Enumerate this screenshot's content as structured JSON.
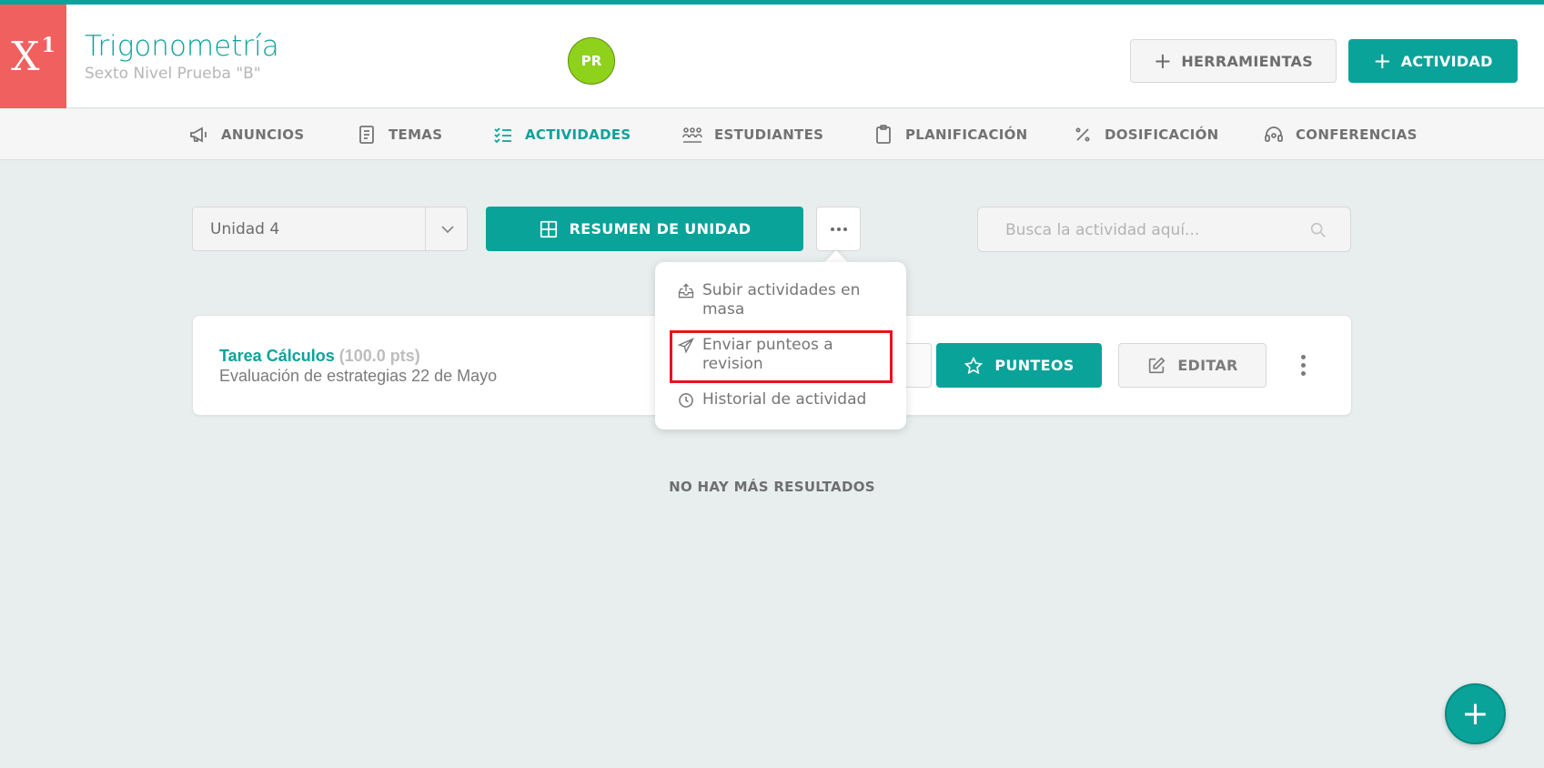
{
  "colors": {
    "brand": "#0aa39a",
    "logo_bg": "#f0605f",
    "avatar_bg": "#8ed21c",
    "highlight": "#e8131b"
  },
  "header": {
    "logo_text": "X",
    "logo_sup": "1",
    "course_title": "Trigonometría",
    "course_subtitle": "Sexto Nivel Prueba \"B\"",
    "avatar_initials": "PR",
    "tools_label": "HERRAMIENTAS",
    "activity_label": "ACTIVIDAD"
  },
  "nav": {
    "items": [
      {
        "label": "ANUNCIOS",
        "icon": "megaphone-icon"
      },
      {
        "label": "TEMAS",
        "icon": "book-icon"
      },
      {
        "label": "ACTIVIDADES",
        "icon": "checklist-icon",
        "active": true
      },
      {
        "label": "ESTUDIANTES",
        "icon": "students-icon"
      },
      {
        "label": "PLANIFICACIÓN",
        "icon": "clipboard-icon"
      },
      {
        "label": "DOSIFICACIÓN",
        "icon": "percent-icon"
      },
      {
        "label": "CONFERENCIAS",
        "icon": "headset-icon"
      }
    ]
  },
  "toolbar": {
    "unit_value": "Unidad 4",
    "summary_label": "RESUMEN DE UNIDAD",
    "search_placeholder": "Busca la actividad aquí..."
  },
  "dropdown": {
    "items": [
      {
        "label": "Subir actividades en masa",
        "icon": "upload-tray-icon"
      },
      {
        "label": "Enviar punteos a revision",
        "icon": "paper-plane-icon",
        "highlighted": true
      },
      {
        "label": "Historial de actividad",
        "icon": "clock-icon"
      }
    ]
  },
  "activity": {
    "title": "Tarea Cálculos",
    "points": "(100.0 pts)",
    "subtitle": "Evaluación de estrategias 22 de Mayo",
    "punteos_label": "PUNTEOS",
    "edit_label": "EDITAR"
  },
  "footer": {
    "no_more_results": "NO HAY MÁS RESULTADOS",
    "fab_label": "+"
  }
}
